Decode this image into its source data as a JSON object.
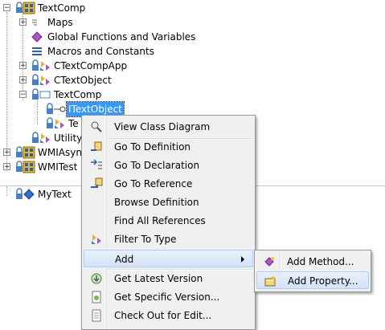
{
  "tree": {
    "root": "TextComp",
    "maps": "Maps",
    "global": "Global Functions and Variables",
    "macros": "Macros and Constants",
    "app": "CTextCompApp",
    "obj": "CTextObject",
    "ns": "TextComp",
    "iface": "ITextObject",
    "te": "Te",
    "utility": "Utility",
    "wmiasync": "WMIAsyn",
    "wmitest": "WMITest",
    "mytext": "MyText"
  },
  "context_menu": {
    "items": [
      {
        "label": "View Class Diagram",
        "icon": "class-diagram-icon"
      },
      {
        "label": "Go To Definition",
        "icon": "goto-definition-icon"
      },
      {
        "label": "Go To Declaration",
        "icon": "goto-declaration-icon"
      },
      {
        "label": "Go To Reference",
        "icon": "goto-reference-icon"
      },
      {
        "label": "Browse Definition",
        "icon": ""
      },
      {
        "label": "Find All References",
        "icon": ""
      },
      {
        "label": "Filter To Type",
        "icon": "filter-icon"
      },
      {
        "label": "Add",
        "icon": ""
      },
      {
        "label": "Get Latest Version",
        "icon": "get-latest-icon"
      },
      {
        "label": "Get Specific Version...",
        "icon": "get-specific-icon"
      },
      {
        "label": "Check Out for Edit...",
        "icon": "checkout-icon"
      }
    ]
  },
  "submenu": {
    "items": [
      {
        "label": "Add Method...",
        "icon": "add-method-icon"
      },
      {
        "label": "Add Property...",
        "icon": "add-property-icon"
      }
    ]
  },
  "colors": {
    "selection": "#3399ff",
    "hover": "#d4e3f7"
  }
}
